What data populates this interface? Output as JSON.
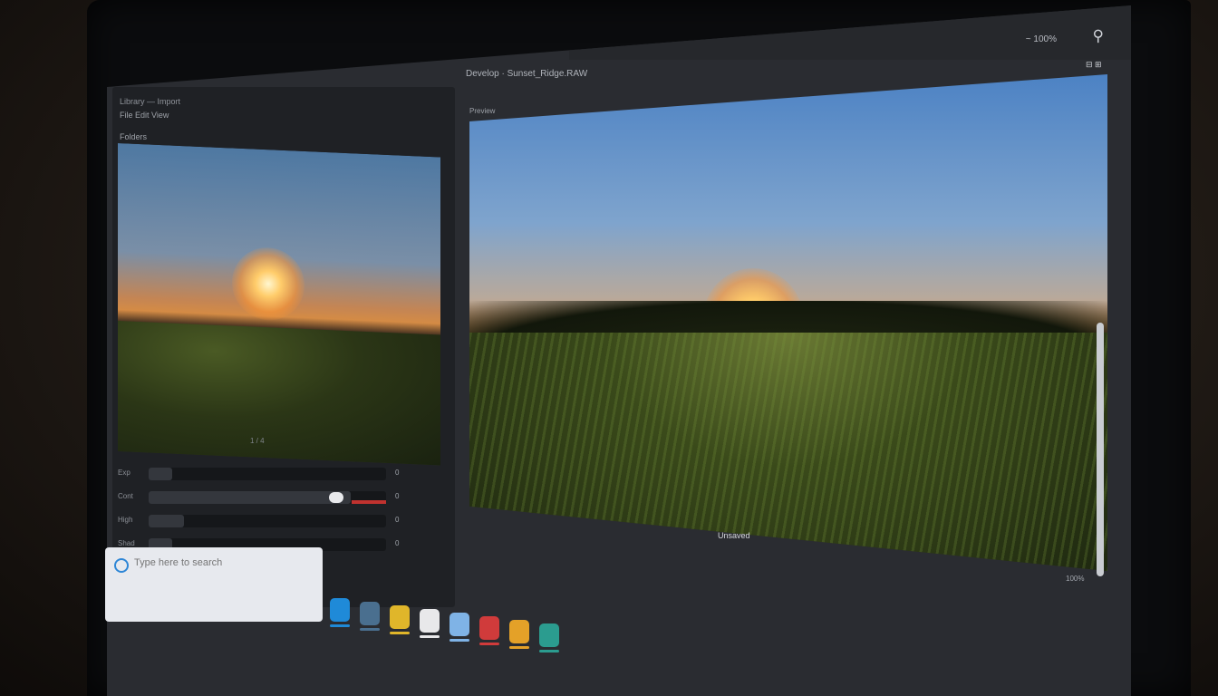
{
  "topbar": {
    "label": "~ 100%",
    "search_icon": "search-icon"
  },
  "left_panel": {
    "title": "Library — Import",
    "toolbar": "File  Edit  View",
    "tab": "Folders",
    "thumb_caption": "1 / 4",
    "properties": [
      {
        "label": "Exp",
        "level": 0.1,
        "value": "0"
      },
      {
        "label": "Cont",
        "level": 0.85,
        "value": "0",
        "accent": "#c0322f"
      },
      {
        "label": "High",
        "level": 0.15,
        "value": "0"
      },
      {
        "label": "Shad",
        "level": 0.1,
        "value": "0"
      }
    ]
  },
  "search": {
    "placeholder": "Type here to search"
  },
  "viewer": {
    "header": "Develop  ·  Sunset_Ridge.RAW",
    "subheader": "Preview",
    "caption": "Unsaved",
    "zoom": "100%",
    "collapse": "⊟ ⊞"
  },
  "taskbar": [
    {
      "icon": "start-icon",
      "color": "#1f8ad8"
    },
    {
      "icon": "folder-icon",
      "color": "#4a6f8f"
    },
    {
      "icon": "browser-icon",
      "color": "#e0b62a"
    },
    {
      "icon": "photos-icon",
      "color": "#e8e8ea"
    },
    {
      "icon": "editor-icon",
      "color": "#7fb3e6"
    },
    {
      "icon": "media-icon",
      "color": "#d03b3b"
    },
    {
      "icon": "viewer-icon",
      "color": "#e4a128"
    },
    {
      "icon": "maps-icon",
      "color": "#2b9c8f"
    }
  ]
}
